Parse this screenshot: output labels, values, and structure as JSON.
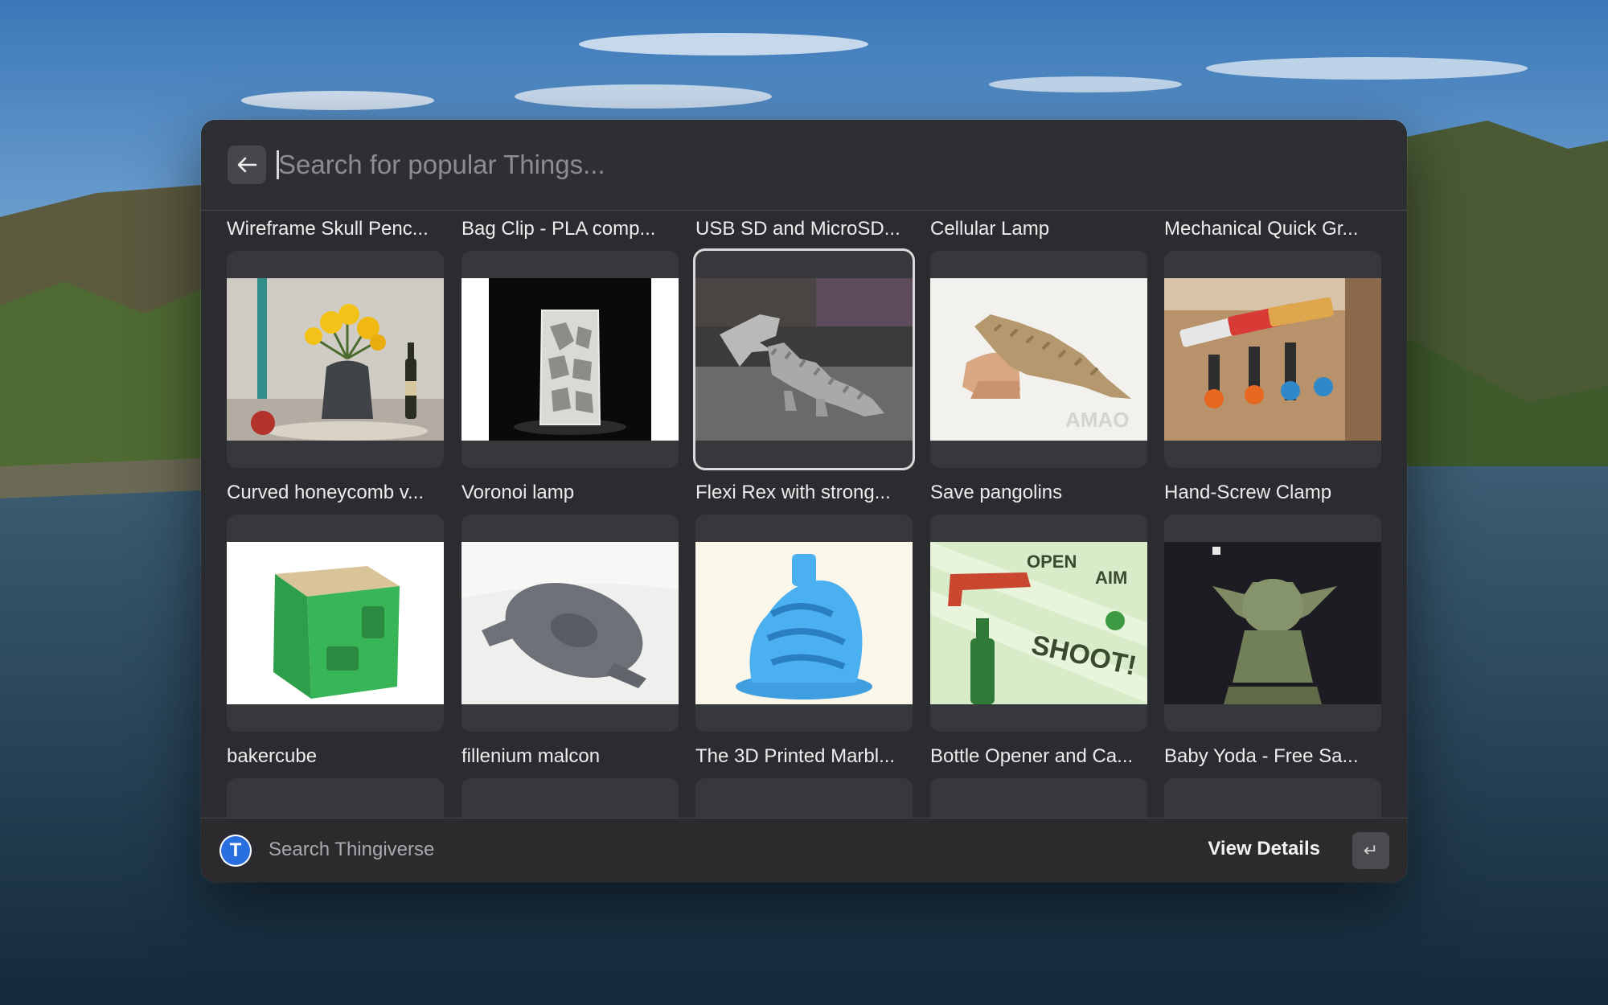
{
  "search": {
    "placeholder": "Search for popular Things..."
  },
  "grid": {
    "row_top": [
      {
        "label": "Wireframe Skull Penc..."
      },
      {
        "label": "Bag Clip - PLA comp..."
      },
      {
        "label": "USB SD and MicroSD..."
      },
      {
        "label": "Cellular Lamp"
      },
      {
        "label": "Mechanical Quick Gr..."
      }
    ],
    "row_middle": [
      {
        "label": "Curved honeycomb v...",
        "icon": "vase-image",
        "selected": false
      },
      {
        "label": "Voronoi lamp",
        "icon": "lamp-image",
        "selected": false
      },
      {
        "label": "Flexi Rex with strong...",
        "icon": "dinosaur-image",
        "selected": true
      },
      {
        "label": "Save pangolins",
        "icon": "pangolin-image",
        "selected": false,
        "watermark": "AMAO"
      },
      {
        "label": "Hand-Screw Clamp",
        "icon": "clamp-image",
        "selected": false
      }
    ],
    "row_bottom": [
      {
        "label": "bakercube",
        "icon": "cube-image"
      },
      {
        "label": "fillenium malcon",
        "icon": "spaceship-image"
      },
      {
        "label": "The 3D Printed Marbl...",
        "icon": "marble-run-image"
      },
      {
        "label": "Bottle Opener and Ca...",
        "icon": "bottle-opener-image",
        "poster_text": [
          "OPEN",
          "AIM",
          "SHOOT!"
        ]
      },
      {
        "label": "Baby Yoda - Free Sa...",
        "icon": "figurine-image"
      }
    ]
  },
  "footer": {
    "title": "Search Thingiverse",
    "logo_letter": "T",
    "action": "View Details",
    "action_key": "↵"
  },
  "colors": {
    "window": "#2a2c30",
    "tile": "#36383c",
    "selection": "#d9d9d9",
    "logo": "#2a6fe0"
  }
}
